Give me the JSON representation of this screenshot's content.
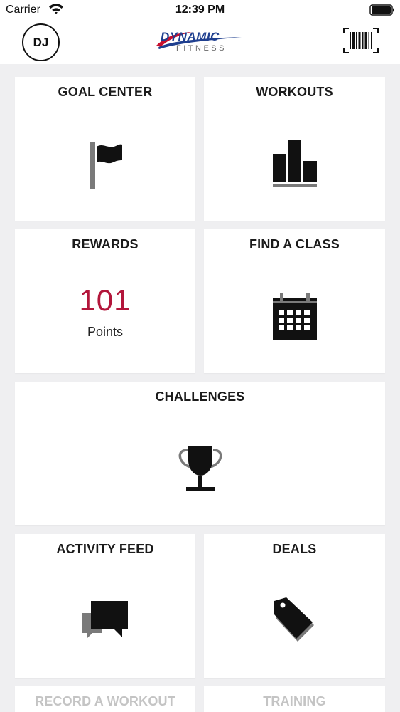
{
  "status_bar": {
    "carrier": "Carrier",
    "time": "12:39 PM"
  },
  "header": {
    "avatar_initials": "DJ",
    "logo_main": "DYNAMIC",
    "logo_sub": "FITNESS",
    "barcode_icon": "barcode-icon"
  },
  "tiles": {
    "goal_center": {
      "title": "GOAL CENTER",
      "icon": "flag-icon"
    },
    "workouts": {
      "title": "WORKOUTS",
      "icon": "bar-chart-icon"
    },
    "rewards": {
      "title": "REWARDS",
      "points": "101",
      "points_label": "Points"
    },
    "find_a_class": {
      "title": "FIND A CLASS",
      "icon": "calendar-icon"
    },
    "challenges": {
      "title": "CHALLENGES",
      "icon": "trophy-icon"
    },
    "activity_feed": {
      "title": "ACTIVITY FEED",
      "icon": "chat-bubbles-icon"
    },
    "deals": {
      "title": "DEALS",
      "icon": "tag-icon"
    },
    "record_a_workout": {
      "title": "RECORD A WORKOUT"
    },
    "training": {
      "title": "TRAINING"
    }
  },
  "colors": {
    "points_accent": "#b3163b",
    "logo_blue": "#1f3f8f",
    "logo_red": "#c8102e",
    "background": "#efeff1"
  }
}
